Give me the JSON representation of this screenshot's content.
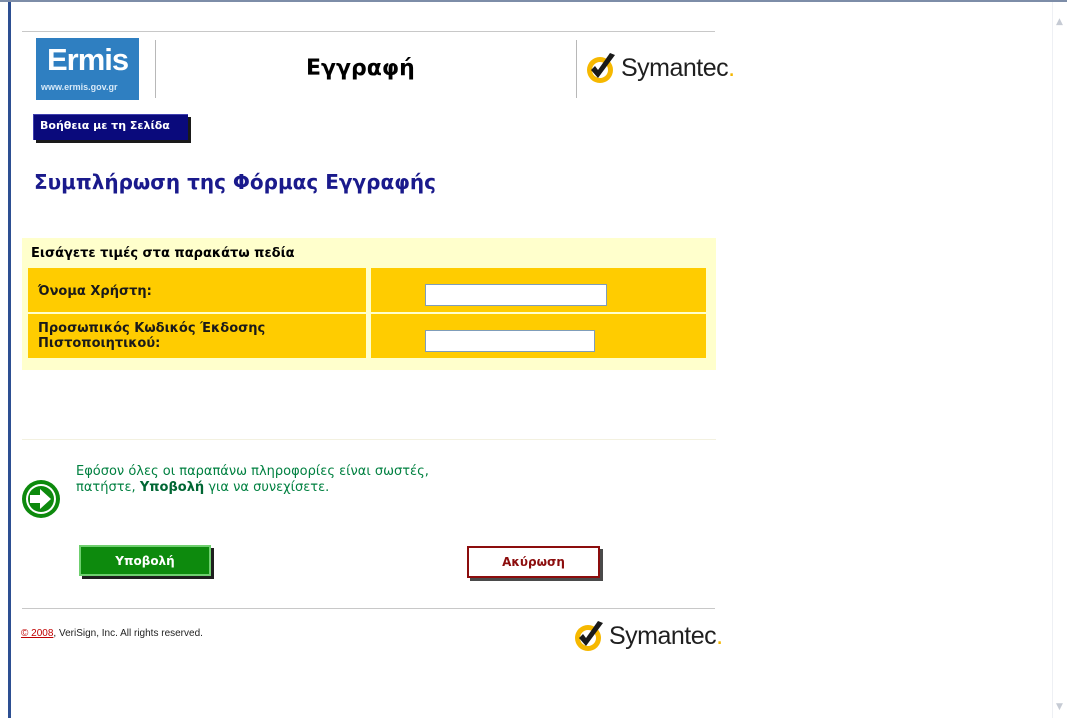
{
  "header": {
    "ermis_logo_text": "Ermis",
    "ermis_logo_url": "www.ermis.gov.gr",
    "title": "Εγγραφή",
    "symantec_logo": "Symantec"
  },
  "help_button_label": "Βοήθεια με τη Σελίδα",
  "form": {
    "heading": "Συμπλήρωση της Φόρμας Εγγραφής",
    "instruction": "Εισάγετε τιμές στα παρακάτω πεδία",
    "fields": [
      {
        "label": "Όνομα Χρήστη:",
        "value": ""
      },
      {
        "label": "Προσωπικός Κωδικός Έκδοσης Πιστοποιητικού:",
        "value": ""
      }
    ]
  },
  "info": {
    "line_before": "Εφόσον όλες οι παραπάνω πληροφορίες είναι σωστές,",
    "line_pre": "πατήστε, ",
    "bold": "Υποβολή",
    "line_post": " για να συνεχίσετε."
  },
  "buttons": {
    "submit": "Υποβολή",
    "cancel": "Ακύρωση"
  },
  "footer": {
    "copyright_link": "© 2008",
    "copyright_rest": ", VeriSign, Inc. All rights reserved.",
    "symantec_logo": "Symantec"
  },
  "icons": {
    "check_icon": "check-icon",
    "arrow_icon": "arrow-right-circle-icon",
    "scroll_up": "chevron-up-icon",
    "scroll_down": "chevron-down-icon"
  },
  "colors": {
    "heading_blue": "#1a1a8c",
    "form_yellow": "#ffcc00",
    "form_bg": "#ffffcc",
    "submit_green": "#0d8a0d",
    "cancel_red": "#8c0d0d",
    "info_green": "#008040"
  }
}
